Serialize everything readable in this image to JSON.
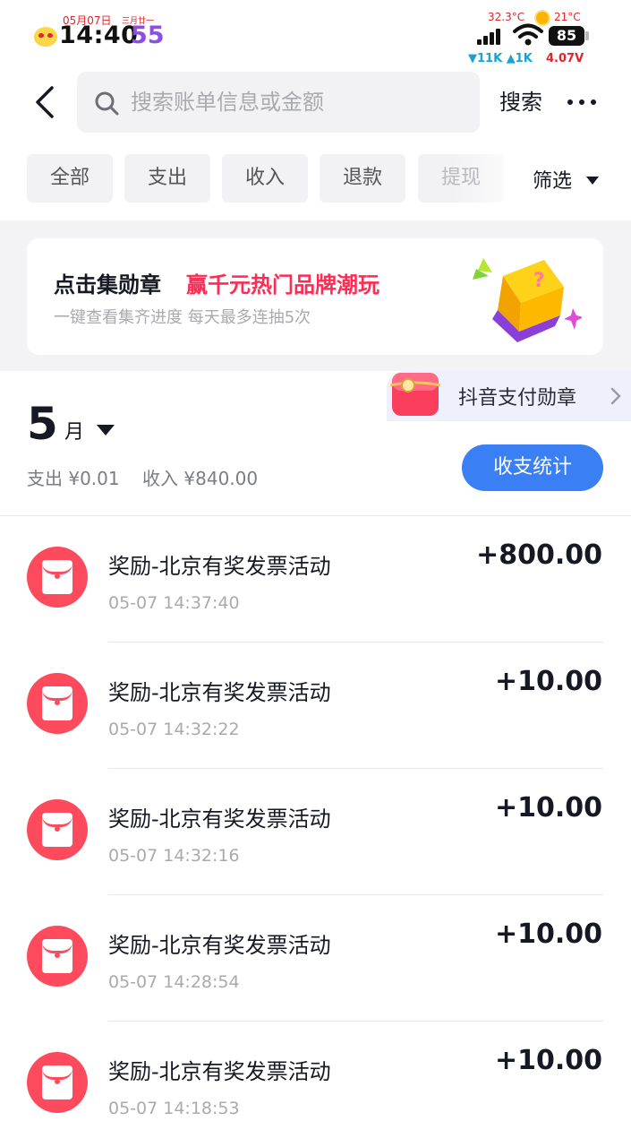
{
  "status_bar": {
    "date": "05月07日",
    "lunar": "三月廿一",
    "time": "14:40",
    "seconds": "55",
    "temperature": "32.3°C",
    "weather_temp": "21°C",
    "battery": "85",
    "net_speed": "▼11K ▲1K",
    "voltage": "4.07V"
  },
  "header": {
    "search_placeholder": "搜索账单信息或金额",
    "search_label": "搜索"
  },
  "tabs": [
    "全部",
    "支出",
    "收入",
    "退款",
    "提现"
  ],
  "filter_label": "筛选",
  "promo": {
    "title": "点击集勋章",
    "highlight": "赢千元热门品牌潮玩",
    "subtitle": "一键查看集齐进度 每天最多连抽5次"
  },
  "badge": {
    "label": "抖音支付勋章"
  },
  "month": {
    "number": "5",
    "unit": "月",
    "summary": "支出 ¥0.01    收入 ¥840.00",
    "stats_button": "收支统计"
  },
  "transactions": [
    {
      "title": "奖励-北京有奖发票活动",
      "time": "05-07 14:37:40",
      "amount": "+800.00"
    },
    {
      "title": "奖励-北京有奖发票活动",
      "time": "05-07 14:32:22",
      "amount": "+10.00"
    },
    {
      "title": "奖励-北京有奖发票活动",
      "time": "05-07 14:32:16",
      "amount": "+10.00"
    },
    {
      "title": "奖励-北京有奖发票活动",
      "time": "05-07 14:28:54",
      "amount": "+10.00"
    },
    {
      "title": "奖励-北京有奖发票活动",
      "time": "05-07 14:18:53",
      "amount": "+10.00"
    }
  ],
  "colors": {
    "accent_blue": "#3a7ff3",
    "highlight_red": "#fe2c55",
    "icon_red": "#fd4a5c"
  }
}
